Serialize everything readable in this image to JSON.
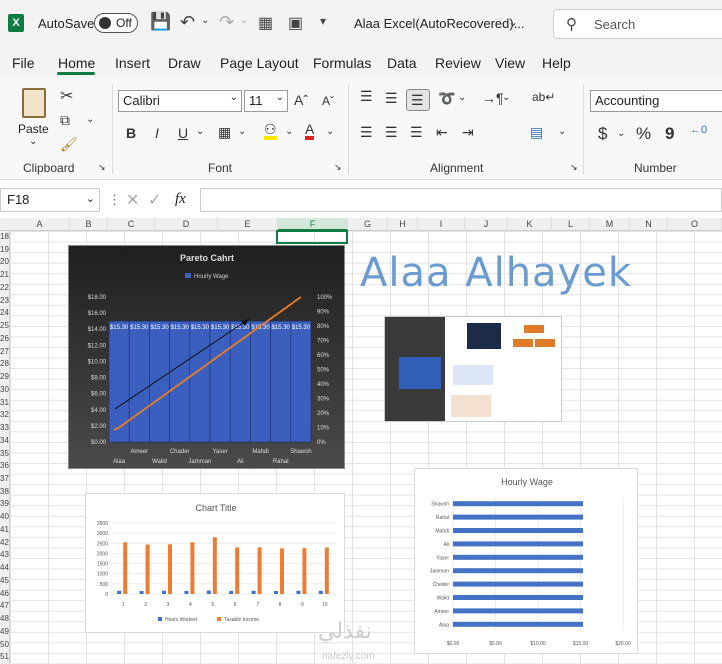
{
  "titlebar": {
    "autosave_label": "AutoSave",
    "autosave_state": "Off",
    "filename": "Alaa Excel(AutoRecovered)...",
    "search_placeholder": "Search"
  },
  "menu": {
    "tabs": [
      "File",
      "Home",
      "Insert",
      "Draw",
      "Page Layout",
      "Formulas",
      "Data",
      "Review",
      "View",
      "Help"
    ],
    "active": "Home"
  },
  "ribbon": {
    "paste_label": "Paste",
    "clipboard_label": "Clipboard",
    "font_label": "Font",
    "alignment_label": "Alignment",
    "number_label": "Number",
    "font_name": "Calibri",
    "font_size": "11",
    "number_format": "Accounting",
    "bold": "B",
    "italic": "I",
    "underline": "U",
    "currency": "$",
    "percent": "%",
    "comma": "9"
  },
  "formula": {
    "name_box": "F18",
    "fx": "fx",
    "value": ""
  },
  "grid": {
    "columns": [
      "A",
      "B",
      "C",
      "D",
      "E",
      "F",
      "G",
      "H",
      "I",
      "J",
      "K",
      "L",
      "M",
      "N",
      "O"
    ],
    "rows": [
      "18",
      "19",
      "20",
      "21",
      "22",
      "23",
      "24",
      "25",
      "26",
      "27",
      "28",
      "29",
      "30",
      "31",
      "32",
      "33",
      "34",
      "35",
      "36",
      "37",
      "38",
      "39",
      "40",
      "41",
      "42",
      "43",
      "44",
      "45",
      "46",
      "47",
      "48",
      "49",
      "50",
      "51"
    ],
    "selected_column": "F"
  },
  "wordart": {
    "text": "Alaa Alhayek"
  },
  "watermark": {
    "arabic": "نفذلي",
    "latin": "nafezly.com"
  },
  "chart_data": [
    {
      "type": "bar",
      "title": "Pareto Cahrt",
      "legend": [
        "Hourly Wage"
      ],
      "categories": [
        "Alaa",
        "Ameer",
        "Walid",
        "Cheder",
        "Jamman",
        "Yaser",
        "Ali",
        "Mahdi",
        "Rahal",
        "Shawsh"
      ],
      "x_labels_row1": [
        "Ameer",
        "Chader",
        "Yaser",
        "Mahdi",
        "Shawsh"
      ],
      "x_labels_row2": [
        "Alaa",
        "Walid",
        "Jamman",
        "Ali",
        "Rahal"
      ],
      "values": [
        15,
        15,
        15,
        15,
        15,
        15,
        15,
        15,
        15,
        15
      ],
      "data_labels": [
        "$15.30",
        "$15.30",
        "$15.30",
        "$15.30",
        "$15.30",
        "$15.30",
        "$15.30",
        "$15.30",
        "$15.30",
        "$15.30"
      ],
      "y_ticks": [
        "$18.00",
        "$16.00",
        "$14.00",
        "$12.00",
        "$10.00",
        "$8.00",
        "$6.00",
        "$4.00",
        "$2.00",
        "$0.00"
      ],
      "y2_ticks": [
        "100%",
        "90%",
        "80%",
        "70%",
        "60%",
        "50%",
        "40%",
        "30%",
        "20%",
        "10%",
        "0%"
      ],
      "ylim": [
        0,
        18
      ],
      "y2lim": [
        0,
        100
      ],
      "cumulative_pct": [
        10,
        20,
        30,
        40,
        50,
        60,
        70,
        80,
        90,
        100
      ],
      "colors": {
        "bar": "#3a5fbf",
        "line": "#e07b2a",
        "background": "#3d3d3d"
      }
    },
    {
      "type": "bar",
      "title": "Chart Title",
      "categories": [
        "1",
        "2",
        "3",
        "4",
        "5",
        "6",
        "7",
        "8",
        "9",
        "10"
      ],
      "series": [
        {
          "name": "Hours Worked",
          "values": [
            160,
            150,
            160,
            150,
            170,
            150,
            160,
            150,
            160,
            160
          ]
        },
        {
          "name": "Taxable Income",
          "values": [
            2550,
            2440,
            2450,
            2550,
            2800,
            2300,
            2300,
            2250,
            2260,
            2290
          ]
        }
      ],
      "y_ticks": [
        "3500",
        "3000",
        "2500",
        "2000",
        "1500",
        "1000",
        "500",
        "0"
      ],
      "ylim": [
        0,
        3500
      ],
      "colors": {
        "s1": "#4472c4",
        "s2": "#ed7d31"
      }
    },
    {
      "type": "bar",
      "orientation": "horizontal",
      "title": "Hourly Wage",
      "categories": [
        "Alaa",
        "Ameer",
        "Walid",
        "Cheder",
        "Jamman",
        "Yaser",
        "Ali",
        "Mahdi",
        "Rahal",
        "Shawsh"
      ],
      "values": [
        15.3,
        15.3,
        15.3,
        15.3,
        15.3,
        15.3,
        15.3,
        15.3,
        15.3,
        15.3
      ],
      "x_ticks": [
        "$0.00",
        "$5.00",
        "$10.00",
        "$15.00",
        "$20.00"
      ],
      "xlim": [
        0,
        20
      ],
      "colors": {
        "bar": "#4472c4"
      }
    }
  ]
}
